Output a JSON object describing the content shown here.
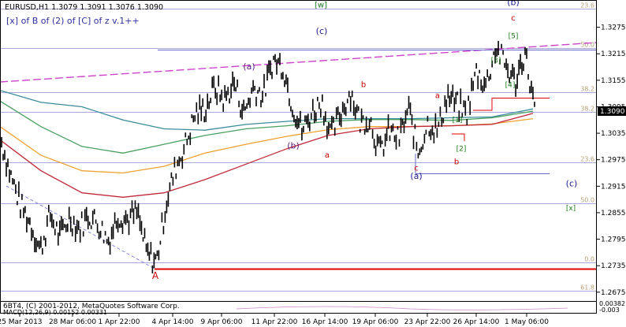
{
  "colors": {
    "background": "#ffffff",
    "price": "#000000",
    "frame": "#000000",
    "fib_line": "#8c8ccc",
    "fib_label": "#b4a078",
    "channel": "#cc44cc",
    "support_red": "#dd0000",
    "ma_teal": "#3c8c9c",
    "ma_green": "#48a060",
    "ma_orange": "#f0a030",
    "ma_red": "#c02838",
    "wave_blue": "#202090",
    "wave_green": "#1a7a1a",
    "wave_red": "#cc0000",
    "wave_purple": "#602080",
    "price_tag_bg": "#000000",
    "price_tag_text": "#ffffff"
  },
  "chart_data": {
    "type": "candlestick",
    "symbol_line": "EURUSD,H1  1.3079 1.3091 1.3076 1.3090",
    "subtitle": "[x] of B of (2) of [C] of z v.1++",
    "current_price": "1.3090",
    "y_ticks": [
      "1.3275",
      "1.3215",
      "1.3155",
      "1.3095",
      "1.3035",
      "1.2975",
      "1.2915",
      "1.2855",
      "1.2795",
      "1.2735",
      "1.2675"
    ],
    "ylim": [
      1.2655,
      1.3335
    ],
    "x_ticks": [
      "25 Mar 2013",
      "28 Mar 06:00",
      "1 Apr 22:00",
      "4 Apr 14:00",
      "9 Apr 06:00",
      "11 Apr 22:00",
      "16 Apr 14:00",
      "19 Apr 06:00",
      "23 Apr 22:00",
      "26 Apr 14:00",
      "1 May 06:00"
    ],
    "path_y": [
      1.3015,
      1.2935,
      1.287,
      1.283,
      1.277,
      1.285,
      1.28,
      1.2845,
      1.282,
      1.285,
      1.283,
      1.279,
      1.285,
      1.284,
      1.2855,
      1.276,
      1.2745,
      1.288,
      1.296,
      1.301,
      1.308,
      1.309,
      1.314,
      1.311,
      1.315,
      1.308,
      1.314,
      1.312,
      1.32,
      1.319,
      1.31,
      1.304,
      1.308,
      1.311,
      1.303,
      1.308,
      1.313,
      1.306,
      1.307,
      1.299,
      1.304,
      1.302,
      1.309,
      1.299,
      1.306,
      1.304,
      1.312,
      1.31,
      1.308,
      1.3175,
      1.3145,
      1.323,
      1.319,
      1.315,
      1.322,
      1.309
    ],
    "moving_averages": [
      {
        "color_key": "ma_teal",
        "y": [
          1.3132,
          1.3105,
          1.3095,
          1.3065,
          1.3045,
          1.3042,
          1.3055,
          1.3062,
          1.3068,
          1.3068,
          1.3068,
          1.307,
          1.3072,
          1.309
        ]
      },
      {
        "color_key": "ma_green",
        "y": [
          1.3108,
          1.305,
          1.3005,
          1.299,
          1.301,
          1.303,
          1.3045,
          1.3052,
          1.3062,
          1.3066,
          1.3066,
          1.3064,
          1.307,
          1.3085
        ]
      },
      {
        "color_key": "ma_orange",
        "y": [
          1.305,
          1.2985,
          1.295,
          1.2945,
          1.296,
          1.299,
          1.301,
          1.3028,
          1.3043,
          1.305,
          1.305,
          1.3052,
          1.3056,
          1.3068
        ]
      },
      {
        "color_key": "ma_red",
        "y": [
          1.302,
          1.295,
          1.29,
          1.289,
          1.29,
          1.293,
          1.2965,
          1.3,
          1.303,
          1.3045,
          1.305,
          1.3052,
          1.3055,
          1.308
        ]
      }
    ],
    "fib_levels": [
      {
        "y": 1.3318,
        "label": "23.6"
      },
      {
        "y": 1.3228,
        "label": "50.0"
      },
      {
        "y": 1.3128,
        "label": "38.2"
      },
      {
        "y": 1.3083,
        "label": "38.2"
      },
      {
        "y": 1.297,
        "label": "23.6"
      },
      {
        "y": 1.2877,
        "label": "50.0"
      },
      {
        "y": 1.2742,
        "label": "0.0"
      },
      {
        "y": 1.2678,
        "label": "61.8"
      }
    ],
    "wave_labels": [
      {
        "text": "(b)",
        "color_key": "wave_blue",
        "y": 1.3325
      },
      {
        "text": "[w]",
        "color_key": "wave_green",
        "y": 1.332
      },
      {
        "text": "c",
        "color_key": "wave_red",
        "y": 1.329
      },
      {
        "text": "(c)",
        "color_key": "wave_blue",
        "y": 1.326
      },
      {
        "text": "[5]",
        "color_key": "wave_green",
        "y": 1.325
      },
      {
        "text": "[3]",
        "color_key": "wave_green",
        "y": 1.3195
      },
      {
        "text": "(a)",
        "color_key": "wave_purple",
        "y": 1.318
      },
      {
        "text": "[4]",
        "color_key": "wave_green",
        "y": 1.314
      },
      {
        "text": "b",
        "color_key": "wave_red",
        "y": 1.314
      },
      {
        "text": "a",
        "color_key": "wave_red",
        "y": 1.3115
      },
      {
        "text": "[1]",
        "color_key": "wave_green",
        "y": 1.306
      },
      {
        "text": "(b)",
        "color_key": "wave_purple",
        "y": 1.3
      },
      {
        "text": "[2]",
        "color_key": "wave_green",
        "y": 1.2995
      },
      {
        "text": "a",
        "color_key": "wave_red",
        "y": 1.298
      },
      {
        "text": "b",
        "color_key": "wave_red",
        "y": 1.2965
      },
      {
        "text": "c",
        "color_key": "wave_red",
        "y": 1.295
      },
      {
        "text": "(a)",
        "color_key": "wave_blue",
        "y": 1.2932
      },
      {
        "text": "(c)",
        "color_key": "wave_blue",
        "y": 1.2915
      },
      {
        "text": "[x]",
        "color_key": "wave_green",
        "y": 1.286
      },
      {
        "text": "A",
        "color_key": "wave_red",
        "y": 1.2705
      }
    ],
    "footer_text": "6BT4, (C) 2001-2012, MetaQuotes Software Corp.",
    "indicator_text": "MACD(12,26,9) 0.00152 0.00331",
    "indicator_ticks": [
      "0.00382",
      "-0.003"
    ]
  }
}
